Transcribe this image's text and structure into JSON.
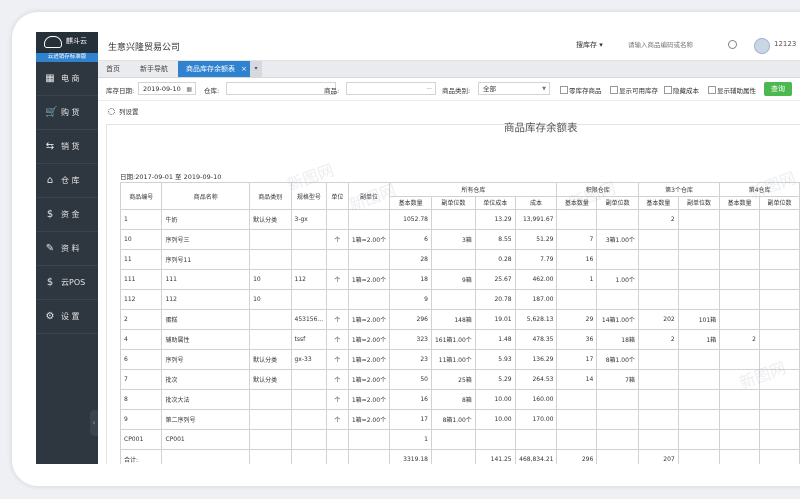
{
  "app": {
    "logo_name": "麒斗云",
    "version_label": "云进销存标准版",
    "company": "生意兴隆贸易公司",
    "user": "12123"
  },
  "search": {
    "type": "搜库存 ▾",
    "placeholder": "请输入商品编码或名称"
  },
  "sidebar": {
    "items": [
      {
        "label": "电 商",
        "icon": "shop-icon",
        "glyph": "▦"
      },
      {
        "label": "购 货",
        "icon": "cart-icon",
        "glyph": "🛒"
      },
      {
        "label": "销 货",
        "icon": "sales-icon",
        "glyph": "⇆"
      },
      {
        "label": "仓 库",
        "icon": "warehouse-icon",
        "glyph": "⌂"
      },
      {
        "label": "资 金",
        "icon": "money-icon",
        "glyph": "$"
      },
      {
        "label": "资 料",
        "icon": "pencil-icon",
        "glyph": "✎"
      },
      {
        "label": "云POS",
        "icon": "pos-icon",
        "glyph": "$"
      },
      {
        "label": "设 置",
        "icon": "gear-icon",
        "glyph": "⚙"
      }
    ],
    "collapse_glyph": "‹"
  },
  "tabs": [
    {
      "label": "首页"
    },
    {
      "label": "新手导航"
    },
    {
      "label": "商品库存余额表"
    }
  ],
  "tab_close": "×",
  "tab_more": "▾",
  "filters": {
    "date_label": "库存日期:",
    "date_value": "2019-09-10",
    "warehouse_label": "仓库:",
    "warehouse_value": "",
    "product_label": "商品:",
    "product_value": "",
    "category_label": "商品类别:",
    "category_value": "全部",
    "dots": "···",
    "checkboxes": [
      "零库存商品",
      "显示可用库存",
      "隐藏成本",
      "显示辅助属性"
    ],
    "query_label": "查询"
  },
  "column_settings_label": "列设置",
  "report": {
    "title": "商品库存余额表",
    "date_range": "日期:2017-09-01 至 2019-09-10",
    "headers": {
      "code": "商品编号",
      "name": "商品名称",
      "category": "商品类别",
      "spec": "规格型号",
      "unit": "单位",
      "sub_unit": "副单位",
      "group1": "所有仓库",
      "group2": "积限仓库",
      "group3": "第3个仓库",
      "group4": "第4仓库",
      "base_qty": "基本数量",
      "sub_qty": "副单位数",
      "unit_cost": "单位成本",
      "cost": "成本"
    },
    "rows": [
      [
        "1",
        "牛奶",
        "默认分类",
        "3-gx",
        "",
        "",
        "1052.78",
        "",
        "13.29",
        "13,991.67",
        "",
        "",
        "2",
        "",
        "",
        ""
      ],
      [
        "10",
        "序列号三",
        "",
        "",
        "个",
        "1箱=2.00个",
        "6",
        "3箱",
        "8.55",
        "51.29",
        "7",
        "3箱1.00个",
        "",
        "",
        "",
        ""
      ],
      [
        "11",
        "序列号11",
        "",
        "",
        "",
        "",
        "28",
        "",
        "0.28",
        "7.79",
        "16",
        "",
        "",
        "",
        "",
        ""
      ],
      [
        "111",
        "111",
        "10",
        "112",
        "个",
        "1箱=2.00个",
        "18",
        "9箱",
        "25.67",
        "462.00",
        "1",
        "1.00个",
        "",
        "",
        "",
        ""
      ],
      [
        "112",
        "112",
        "10",
        "",
        "",
        "",
        "9",
        "",
        "20.78",
        "187.00",
        "",
        "",
        "",
        "",
        "",
        ""
      ],
      [
        "2",
        "蛋糕",
        "",
        "453156...",
        "个",
        "1箱=2.00个",
        "296",
        "148箱",
        "19.01",
        "5,628.13",
        "29",
        "14箱1.00个",
        "202",
        "101箱",
        "",
        ""
      ],
      [
        "4",
        "辅助属性",
        "",
        "tssf",
        "个",
        "1箱=2.00个",
        "323",
        "161箱1.00个",
        "1.48",
        "478.35",
        "36",
        "18箱",
        "2",
        "1箱",
        "2",
        ""
      ],
      [
        "6",
        "序列号",
        "默认分类",
        "gx-33",
        "个",
        "1箱=2.00个",
        "23",
        "11箱1.00个",
        "5.93",
        "136.29",
        "17",
        "8箱1.00个",
        "",
        "",
        "",
        ""
      ],
      [
        "7",
        "批次",
        "默认分类",
        "",
        "个",
        "1箱=2.00个",
        "50",
        "25箱",
        "5.29",
        "264.53",
        "14",
        "7箱",
        "",
        "",
        "",
        ""
      ],
      [
        "8",
        "批次大法",
        "",
        "",
        "个",
        "1箱=2.00个",
        "16",
        "8箱",
        "10.00",
        "160.00",
        "",
        "",
        "",
        "",
        "",
        ""
      ],
      [
        "9",
        "第二序列号",
        "",
        "",
        "个",
        "1箱=2.00个",
        "17",
        "8箱1.00个",
        "10.00",
        "170.00",
        "",
        "",
        "",
        "",
        "",
        ""
      ],
      [
        "CP001",
        "CP001",
        "",
        "",
        "",
        "",
        "1",
        "",
        "",
        "",
        "",
        "",
        "",
        "",
        "",
        ""
      ]
    ],
    "total": {
      "label": "合计:",
      "base_qty": "3319.18",
      "unit_cost": "141.25",
      "cost": "468,834.21",
      "g2_qty": "296",
      "g3_qty": "207"
    },
    "watermark": "新图网"
  }
}
